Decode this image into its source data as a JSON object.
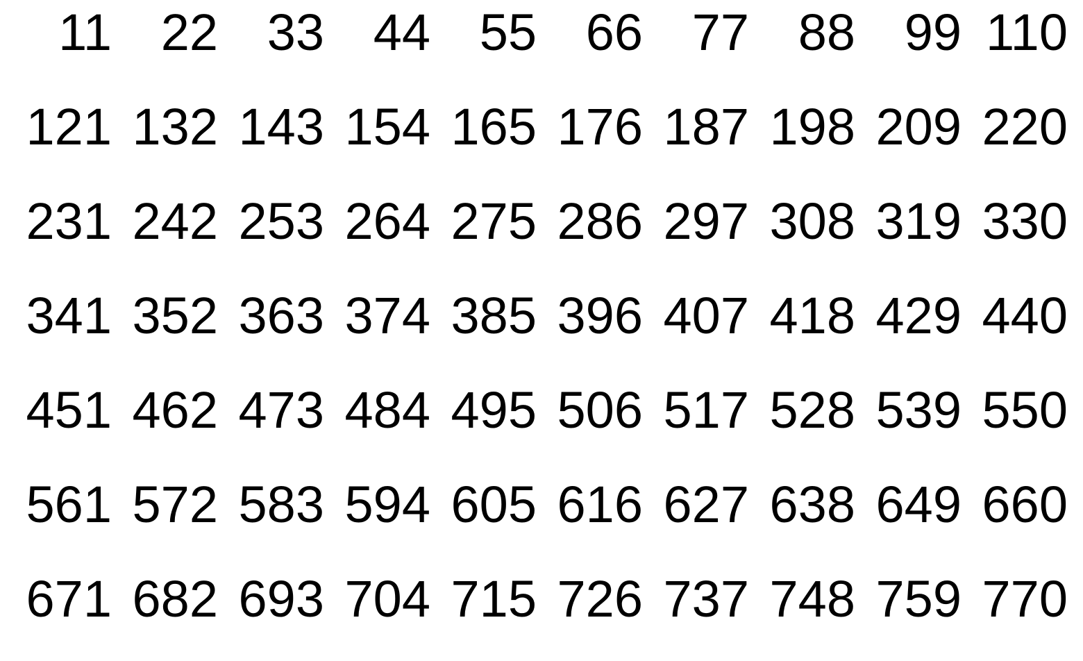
{
  "rows": [
    [
      "11",
      "22",
      "33",
      "44",
      "55",
      "66",
      "77",
      "88",
      "99",
      "110"
    ],
    [
      "121",
      "132",
      "143",
      "154",
      "165",
      "176",
      "187",
      "198",
      "209",
      "220"
    ],
    [
      "231",
      "242",
      "253",
      "264",
      "275",
      "286",
      "297",
      "308",
      "319",
      "330"
    ],
    [
      "341",
      "352",
      "363",
      "374",
      "385",
      "396",
      "407",
      "418",
      "429",
      "440"
    ],
    [
      "451",
      "462",
      "473",
      "484",
      "495",
      "506",
      "517",
      "528",
      "539",
      "550"
    ],
    [
      "561",
      "572",
      "583",
      "594",
      "605",
      "616",
      "627",
      "638",
      "649",
      "660"
    ],
    [
      "671",
      "682",
      "693",
      "704",
      "715",
      "726",
      "737",
      "748",
      "759",
      "770"
    ]
  ],
  "colors": {
    "text": "#000000",
    "background": "#ffffff"
  }
}
